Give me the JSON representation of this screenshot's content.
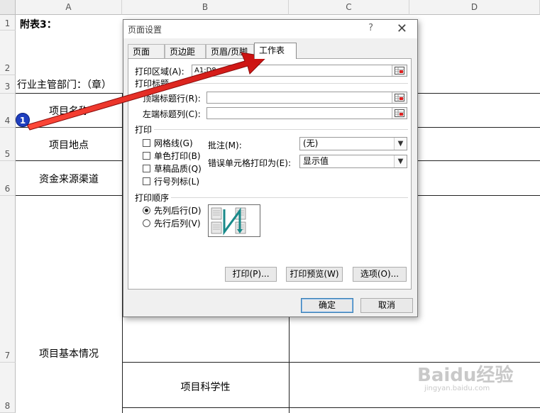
{
  "sheet": {
    "columns": [
      "A",
      "B",
      "C",
      "D"
    ],
    "rows": [
      "1",
      "2",
      "3",
      "4",
      "5",
      "6",
      "7",
      "8"
    ],
    "cells": {
      "a1": "附表3：",
      "a3": "行业主管部门：（章）",
      "a4": "项目名称",
      "a5": "项目地点",
      "a6": "资金来源渠道",
      "a7": "项目基本情况",
      "b8": "项目科学性"
    }
  },
  "dialog": {
    "title": "页面设置",
    "help": "?",
    "close": "✕",
    "tabs": [
      "页面",
      "页边距",
      "页眉/页脚",
      "工作表"
    ],
    "active_tab": "工作表",
    "print_area_label": "打印区域(A):",
    "print_area_value": "A1:D8",
    "print_titles_label": "打印标题",
    "top_rows_label": "顶端标题行(R):",
    "top_rows_value": "",
    "left_cols_label": "左端标题列(C):",
    "left_cols_value": "",
    "print_section_label": "打印",
    "checkboxes": [
      "网格线(G)",
      "单色打印(B)",
      "草稿品质(Q)",
      "行号列标(L)"
    ],
    "comments_label": "批注(M):",
    "comments_value": "(无)",
    "errors_label": "错误单元格打印为(E):",
    "errors_value": "显示值",
    "page_order_label": "打印顺序",
    "radio_down_then_over": "先列后行(D)",
    "radio_over_then_down": "先行后列(V)",
    "selected_order": "先列后行(D)",
    "buttons": {
      "print": "打印(P)...",
      "preview": "打印预览(W)",
      "options": "选项(O)...",
      "ok": "确定",
      "cancel": "取消"
    }
  },
  "annotation": {
    "badge": "1",
    "arrow_color": "#e0201a"
  },
  "watermark": {
    "brand": "Baidu经验",
    "url": "jingyan.baidu.com"
  }
}
